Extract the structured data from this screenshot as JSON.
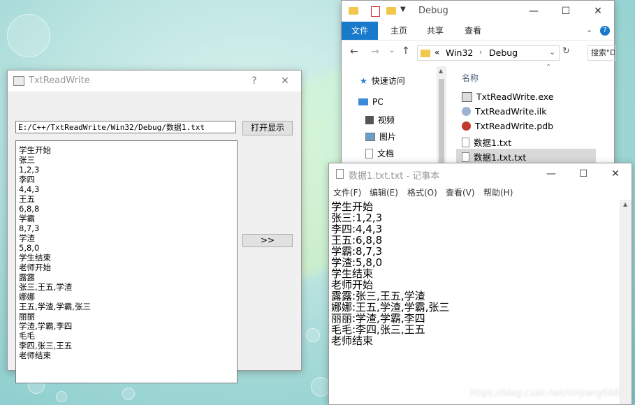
{
  "txtreadwrite": {
    "title": "TxtReadWrite",
    "help": "?",
    "close": "✕",
    "path_value": "E:/C++/TxtReadWrite/Win32/Debug/数据1.txt",
    "open_button": "打开显示",
    "arrow_button": ">>",
    "lines": [
      "学生开始",
      "张三",
      "1,2,3",
      "李四",
      "4,4,3",
      "王五",
      "6,8,8",
      "学霸",
      "8,7,3",
      "学渣",
      "5,8,0",
      "学生结束",
      "老师开始",
      "露露",
      "张三,王五,学渣",
      "娜娜",
      "王五,学渣,学霸,张三",
      "丽丽",
      "学渣,学霸,李四",
      "毛毛",
      "李四,张三,王五",
      "老师结束"
    ]
  },
  "explorer": {
    "title": "Debug",
    "tabs": [
      "文件",
      "主页",
      "共享",
      "查看"
    ],
    "breadcrumb": [
      "Win32",
      "Debug"
    ],
    "breadcrumb_prefix": "«",
    "search_placeholder": "搜索\"D",
    "nav": [
      "快速访问",
      "PC",
      "视频",
      "图片",
      "文档"
    ],
    "column_name": "名称",
    "files": [
      "TxtReadWrite.exe",
      "TxtReadWrite.ilk",
      "TxtReadWrite.pdb",
      "数据1.txt",
      "数据1.txt.txt"
    ]
  },
  "notepad": {
    "title": "数据1.txt.txt - 记事本",
    "menu": [
      "文件(F)",
      "编辑(E)",
      "格式(O)",
      "查看(V)",
      "帮助(H)"
    ],
    "lines": [
      "学生开始",
      "张三:1,2,3",
      "李四:4,4,3",
      "王五:6,8,8",
      "学霸:8,7,3",
      "学渣:5,8,0",
      "学生结束",
      "老师开始",
      "露露:张三,王五,学渣",
      "娜娜:王五,学渣,学霸,张三",
      "丽丽:学渣,学霸,李四",
      "毛毛:李四,张三,王五",
      "老师结束"
    ]
  },
  "watermark": "https://blog.csdn.net/xinjiang666"
}
